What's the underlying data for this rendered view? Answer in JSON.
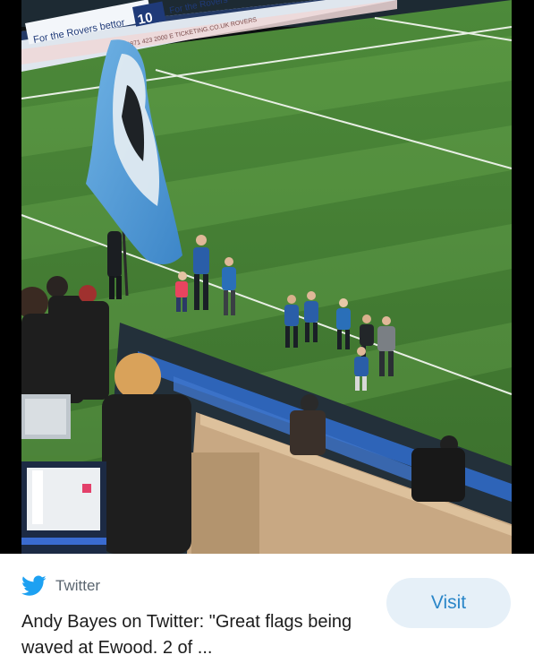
{
  "photo": {
    "ad_boards": {
      "left_text": "For the Rovers bettor",
      "logo_number": "10",
      "right_text": "For the Rovers",
      "ticket_text": "0871 423 2000  E TICKETING.CO.UK ROVERS"
    }
  },
  "card": {
    "source": {
      "icon": "twitter-bird-icon",
      "label": "Twitter"
    },
    "headline": "Andy Bayes on Twitter: \"Great flags being waved at Ewood. 2 of ...",
    "visit_label": "Visit",
    "colors": {
      "twitter_blue": "#1da1f2",
      "visit_bg": "#e6f0f8",
      "visit_text": "#2a86c8"
    }
  }
}
